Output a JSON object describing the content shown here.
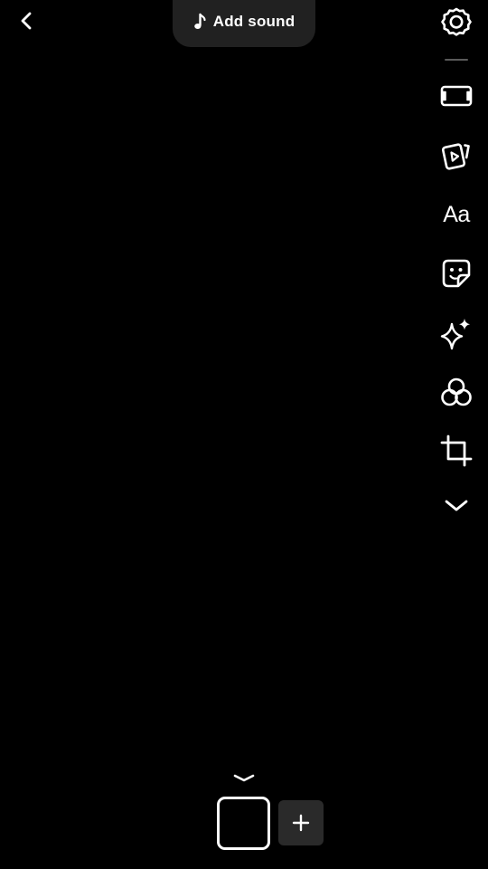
{
  "top_bar": {
    "back_icon": "chevron-left-icon",
    "add_sound": {
      "icon": "music-note-icon",
      "label": "Add sound"
    }
  },
  "toolbar": {
    "items": [
      {
        "id": "settings",
        "icon": "settings-gear-icon"
      },
      {
        "id": "aspect-ratio",
        "icon": "aspect-ratio-icon"
      },
      {
        "id": "clips",
        "icon": "clips-play-icon"
      },
      {
        "id": "text",
        "icon": "text-aa-icon",
        "label": "Aa"
      },
      {
        "id": "stickers",
        "icon": "sticker-icon"
      },
      {
        "id": "effects",
        "icon": "sparkles-icon"
      },
      {
        "id": "filters",
        "icon": "filter-circles-icon"
      },
      {
        "id": "crop",
        "icon": "crop-icon"
      },
      {
        "id": "more",
        "icon": "chevron-down-icon"
      }
    ]
  },
  "bottom": {
    "collapse_icon": "chevron-down-icon",
    "add_clip_icon": "plus-icon"
  },
  "colors": {
    "background": "#000000",
    "pill": "#212121",
    "add_button": "#2a2a2a",
    "foreground": "#ffffff"
  }
}
